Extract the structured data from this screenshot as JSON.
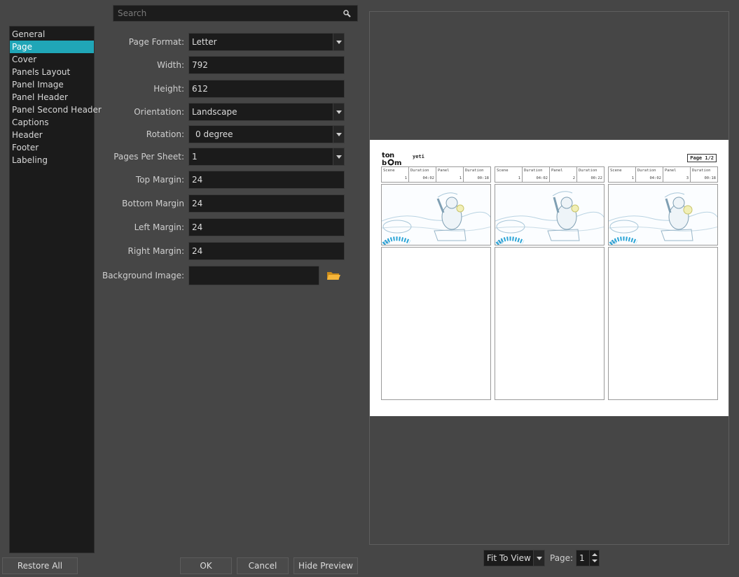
{
  "search": {
    "placeholder": "Search"
  },
  "sidebar": {
    "items": [
      {
        "label": "General"
      },
      {
        "label": "Page"
      },
      {
        "label": "Cover"
      },
      {
        "label": "Panels Layout"
      },
      {
        "label": "Panel Image"
      },
      {
        "label": "Panel Header"
      },
      {
        "label": "Panel Second Header"
      },
      {
        "label": "Captions"
      },
      {
        "label": "Header"
      },
      {
        "label": "Footer"
      },
      {
        "label": "Labeling"
      }
    ],
    "selected": "Page"
  },
  "form": {
    "page_format": {
      "label": "Page Format:",
      "value": "Letter"
    },
    "width": {
      "label": "Width:",
      "value": "792"
    },
    "height": {
      "label": "Height:",
      "value": "612"
    },
    "orientation": {
      "label": "Orientation:",
      "value": "Landscape"
    },
    "rotation": {
      "label": "Rotation:",
      "value": "0 degree"
    },
    "pages_per_sheet": {
      "label": "Pages Per Sheet:",
      "value": "1"
    },
    "top_margin": {
      "label": "Top Margin:",
      "value": "24"
    },
    "bottom_margin": {
      "label": "Bottom Margin",
      "value": "24"
    },
    "left_margin": {
      "label": "Left Margin:",
      "value": "24"
    },
    "right_margin": {
      "label": "Right Margin:",
      "value": "24"
    },
    "background_image": {
      "label": "Background Image:",
      "value": ""
    }
  },
  "preview": {
    "logo_text": "toon boom",
    "project_name": "yeti",
    "page_indicator": "Page 1/2",
    "panel_headers": {
      "scene": "Scene",
      "duration": "Duration",
      "panel": "Panel"
    },
    "panels": [
      {
        "scene": "1",
        "scene_duration": "04:02",
        "panel": "1",
        "panel_duration": "00:18",
        "badge": "OL"
      },
      {
        "scene": "1",
        "scene_duration": "04:02",
        "panel": "2",
        "panel_duration": "00:22",
        "badge": "OL"
      },
      {
        "scene": "1",
        "scene_duration": "04:02",
        "panel": "3",
        "panel_duration": "00:18",
        "badge": "OL"
      }
    ]
  },
  "buttons": {
    "restore_defaults": "Restore All Defaults",
    "ok": "OK",
    "cancel": "Cancel",
    "hide_preview": "Hide Preview"
  },
  "preview_controls": {
    "zoom_value": "Fit To View",
    "page_label": "Page:",
    "page_value": "1"
  },
  "colors": {
    "selection": "#20a6b7",
    "background": "#464646",
    "field": "#1b1b1b"
  },
  "icons": {
    "search": "magnifier-icon",
    "browse": "folder-icon"
  }
}
